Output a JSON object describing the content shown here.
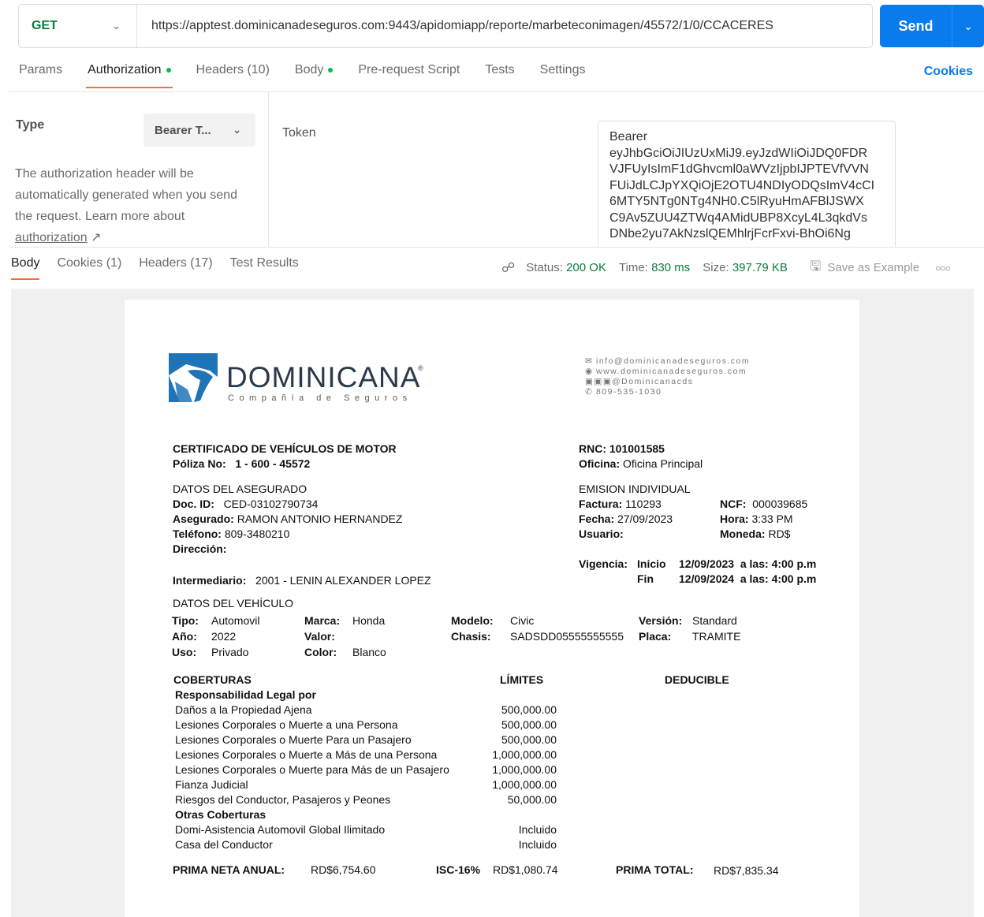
{
  "request": {
    "method": "GET",
    "url": "https://apptest.dominicanadeseguros.com:9443/apidomiapp/reporte/marbeteconimagen/45572/1/0/CCACERES",
    "send_label": "Send"
  },
  "request_tabs": [
    {
      "label": "Params"
    },
    {
      "label": "Authorization"
    },
    {
      "label": "Headers",
      "count": "(10)"
    },
    {
      "label": "Body"
    },
    {
      "label": "Pre-request Script"
    },
    {
      "label": "Tests"
    },
    {
      "label": "Settings"
    }
  ],
  "cookies_link": "Cookies",
  "auth": {
    "type_label": "Type",
    "type_value": "Bearer T...",
    "description": "The authorization header will be automatically generated when you send the request. Learn more about",
    "link_label": "authorization",
    "token_label": "Token",
    "token_lines": [
      "Bearer",
      "eyJhbGciOiJIUzUxMiJ9.eyJzdWIiOiJDQ0FDR",
      "VJFUyIsImF1dGhvcml0aWVzIjpbIJPTEVfVVN",
      "FUiJdLCJpYXQiOjE2OTU4NDIyODQsImV4cCI",
      "6MTY5NTg0NTg4NH0.C5lRyuHmAFBlJSWX",
      "C9Av5ZUU4ZTWq4AMidUBP8XcyL4L3qkdVs",
      "DNbe2yu7AkNzslQEMhlrjFcrFxvi-BhOi6Ng"
    ]
  },
  "response_tabs": [
    {
      "label": "Body"
    },
    {
      "label": "Cookies (1)"
    },
    {
      "label": "Headers (17)"
    },
    {
      "label": "Test Results"
    }
  ],
  "response_meta": {
    "status_label": "Status:",
    "status": "200 OK",
    "time_label": "Time:",
    "time": "830 ms",
    "size_label": "Size:",
    "size": "397.79 KB",
    "save_example": "Save as Example"
  },
  "colors": {
    "accent": "#ff6c37",
    "send": "#097bed",
    "status_ok": "#0c7a3e"
  },
  "document": {
    "logo": {
      "name": "DOMINICANA",
      "subtitle": "Compañía de Seguros"
    },
    "contact": [
      "info@dominicanadeseguros.com",
      "www.dominicanadeseguros.com",
      "@Dominicanacds",
      "809-535-1030"
    ],
    "cert_title": "CERTIFICADO DE VEHÍCULOS DE MOTOR",
    "poliza_label": "Póliza No:",
    "poliza": "1 - 600 - 45572",
    "rnc": "RNC: 101001585",
    "oficina_label": "Oficina:",
    "oficina": "Oficina Principal",
    "asegurado_header": "DATOS DEL ASEGURADO",
    "doc_label": "Doc. ID:",
    "doc": "CED-03102790734",
    "aseg_label": "Asegurado:",
    "aseg": "RAMON ANTONIO HERNANDEZ",
    "tel_label": "Teléfono:",
    "tel": "809-3480210",
    "dir_label": "Dirección:",
    "emision": "EMISION INDIVIDUAL",
    "factura_label": "Factura:",
    "factura": "110293",
    "ncf_label": "NCF:",
    "ncf": "000039685",
    "fecha_label": "Fecha:",
    "fecha": "27/09/2023",
    "hora_label": "Hora:",
    "hora": "3:33 PM",
    "usuario_label": "Usuario:",
    "moneda_label": "Moneda:",
    "moneda": "RD$",
    "vigencia_label": "Vigencia:",
    "inicio_label": "Inicio",
    "inicio": "12/09/2023",
    "fin_label": "Fin",
    "fin": "12/09/2024",
    "las_label": "a las:",
    "hora_vig": "4:00 p.m",
    "intermediario_label": "Intermediario:",
    "intermediario": "2001 - LENIN ALEXANDER LOPEZ",
    "vehiculo_header": "DATOS DEL VEHÍCULO",
    "tipo_label": "Tipo:",
    "tipo": "Automovil",
    "marca_label": "Marca:",
    "marca": "Honda",
    "modelo_label": "Modelo:",
    "modelo": "Civic",
    "version_label": "Versión:",
    "version": "Standard",
    "anio_label": "Año:",
    "anio": "2022",
    "valor_label": "Valor:",
    "chasis_label": "Chasis:",
    "chasis": "SADSDD05555555555",
    "placa_label": "Placa:",
    "placa": "TRAMITE",
    "uso_label": "Uso:",
    "uso": "Privado",
    "color_label": "Color:",
    "color": "Blanco",
    "coberturas_header": "COBERTURAS",
    "limites_header": "LÍMITES",
    "deducible_header": "DEDUCIBLE",
    "resp_legal": "Responsabilidad Legal por",
    "coverages": [
      {
        "name": "Daños a la Propiedad Ajena",
        "limit": "500,000.00"
      },
      {
        "name": "Lesiones Corporales o Muerte a una Persona",
        "limit": "500,000.00"
      },
      {
        "name": "Lesiones Corporales o Muerte Para un Pasajero",
        "limit": "500,000.00"
      },
      {
        "name": "Lesiones Corporales o Muerte a Más de una Persona",
        "limit": "1,000,000.00"
      },
      {
        "name": "Lesiones Corporales o Muerte para Más de un Pasajero",
        "limit": "1,000,000.00"
      },
      {
        "name": "Fianza Judicial",
        "limit": "1,000,000.00"
      },
      {
        "name": "Riesgos del Conductor, Pasajeros y  Peones",
        "limit": "50,000.00"
      }
    ],
    "otras_header": "Otras Coberturas",
    "other_coverages": [
      {
        "name": "Domi-Asistencia Automovil Global Ilimitado",
        "limit": "Incluido"
      },
      {
        "name": "Casa del Conductor",
        "limit": "Incluido"
      }
    ],
    "prima_neta_label": "PRIMA NETA ANUAL:",
    "prima_neta": "RD$6,754.60",
    "isc_label": "ISC-16%",
    "isc": "RD$1,080.74",
    "prima_total_label": "PRIMA TOTAL:",
    "prima_total": "RD$7,835.34"
  }
}
